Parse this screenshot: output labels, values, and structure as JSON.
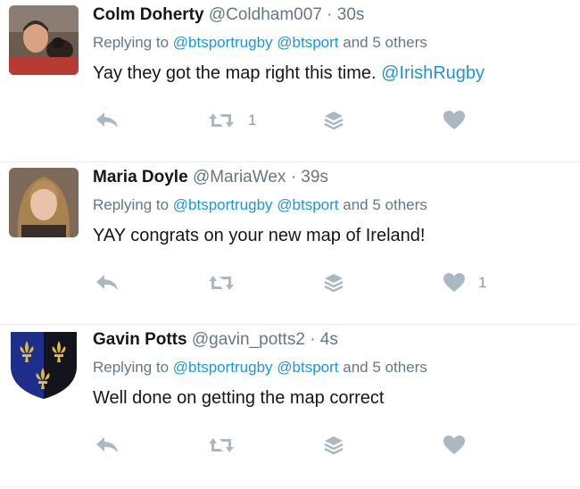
{
  "tweets": [
    {
      "name": "Colm Doherty",
      "handle": "@Coldham007",
      "dot": "·",
      "time": "30s",
      "reply": {
        "prefix": "Replying to",
        "mention1": "@btsportrugby",
        "mention2": "@btsport",
        "suffix": "and 5 others"
      },
      "text": "Yay they got the map right this time.",
      "text_mention": "@IrishRugby",
      "retweet_count": "1",
      "like_count": ""
    },
    {
      "name": "Maria Doyle",
      "handle": "@MariaWex",
      "dot": "·",
      "time": "39s",
      "reply": {
        "prefix": "Replying to",
        "mention1": "@btsportrugby",
        "mention2": "@btsport",
        "suffix": "and 5 others"
      },
      "text": "YAY congrats on your new map of Ireland!",
      "text_mention": "",
      "retweet_count": "",
      "like_count": "1"
    },
    {
      "name": "Gavin Potts",
      "handle": "@gavin_potts2",
      "dot": "·",
      "time": "4s",
      "reply": {
        "prefix": "Replying to",
        "mention1": "@btsportrugby",
        "mention2": "@btsport",
        "suffix": "and 5 others"
      },
      "text": "Well done on getting the map correct",
      "text_mention": "",
      "retweet_count": "",
      "like_count": ""
    }
  ],
  "icons": {
    "reply": "reply-icon",
    "retweet": "retweet-icon",
    "share": "share-stack-icon",
    "like": "heart-icon"
  },
  "colors": {
    "link": "#1b95e0",
    "muted": "#657786",
    "icon": "#aab8c2",
    "divider": "#e6ecf0"
  }
}
